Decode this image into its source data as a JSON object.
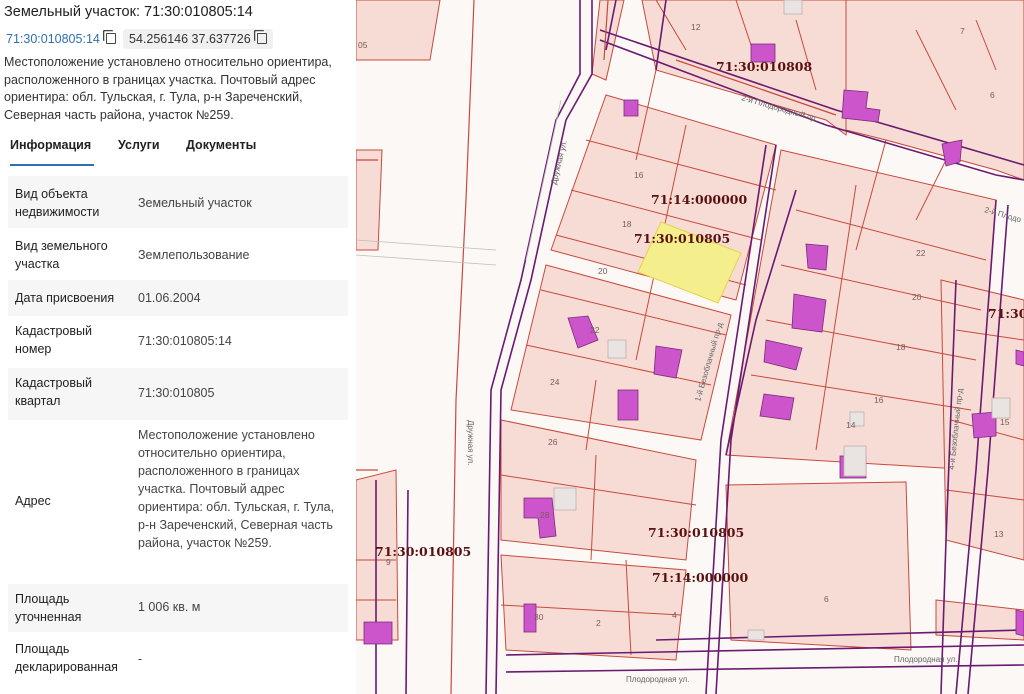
{
  "panel": {
    "title": "Земельный участок: 71:30:010805:14",
    "cadastral_chip": "71:30:010805:14",
    "coords_chip": "54.256146 37.637726",
    "address_summary": "Местоположение установлено относительно ориентира, расположенного в границах участка. Почтовый адрес ориентира: обл. Тульская, г. Тула, р-н Зареченский, Северная часть района, участок №259.",
    "tabs": [
      {
        "label": "Информация",
        "active": true
      },
      {
        "label": "Услуги",
        "active": false
      },
      {
        "label": "Документы",
        "active": false
      }
    ],
    "rows": [
      {
        "label": "Вид объекта недвижимости",
        "value": "Земельный участок"
      },
      {
        "label": "Вид земельного участка",
        "value": "Землепользование"
      },
      {
        "label": "Дата присвоения",
        "value": "01.06.2004"
      },
      {
        "label": "Кадастровый номер",
        "value": "71:30:010805:14"
      },
      {
        "label": "Кадастровый квартал",
        "value": "71:30:010805"
      },
      {
        "label": "Адрес",
        "value": "Местоположение установлено относительно ориентира, расположенного в границах участка. Почтовый адрес ориентира: обл. Тульская, г. Тула, р-н Зареченский, Северная часть района, участок №259."
      },
      {
        "label": "Площадь уточненная",
        "value": "1 006 кв. м"
      },
      {
        "label": "Площадь декларированная",
        "value": "-"
      }
    ]
  },
  "map": {
    "labels": [
      "71:30:010808",
      "71:14:000000",
      "71:30:010805",
      "71:30:010805",
      "71:14:000000",
      "71:30:010805",
      "71:30"
    ],
    "streets": [
      "Дружная ул.",
      "2-й Плодородный пр.",
      "2-й Плодо",
      "Дружная ул.",
      "1-й Безоблачный пр-д",
      "4-й Безоблачный пр-д",
      "Плодородная ул.",
      "Плодородная ул."
    ],
    "plot_numbers": [
      "12",
      "7",
      "6",
      "16",
      "18",
      "20",
      "22",
      "24",
      "26",
      "28",
      "30",
      "2",
      "4",
      "22",
      "20",
      "18",
      "16",
      "14",
      "13",
      "15",
      "9",
      "6",
      "05"
    ],
    "colors": {
      "highlight": "#f4ef8c",
      "building": "#cc55cc",
      "parcel_line": "#c84a3c",
      "quarter_line": "#6a1a70",
      "parcel_fill": "#f7dcd6"
    }
  }
}
